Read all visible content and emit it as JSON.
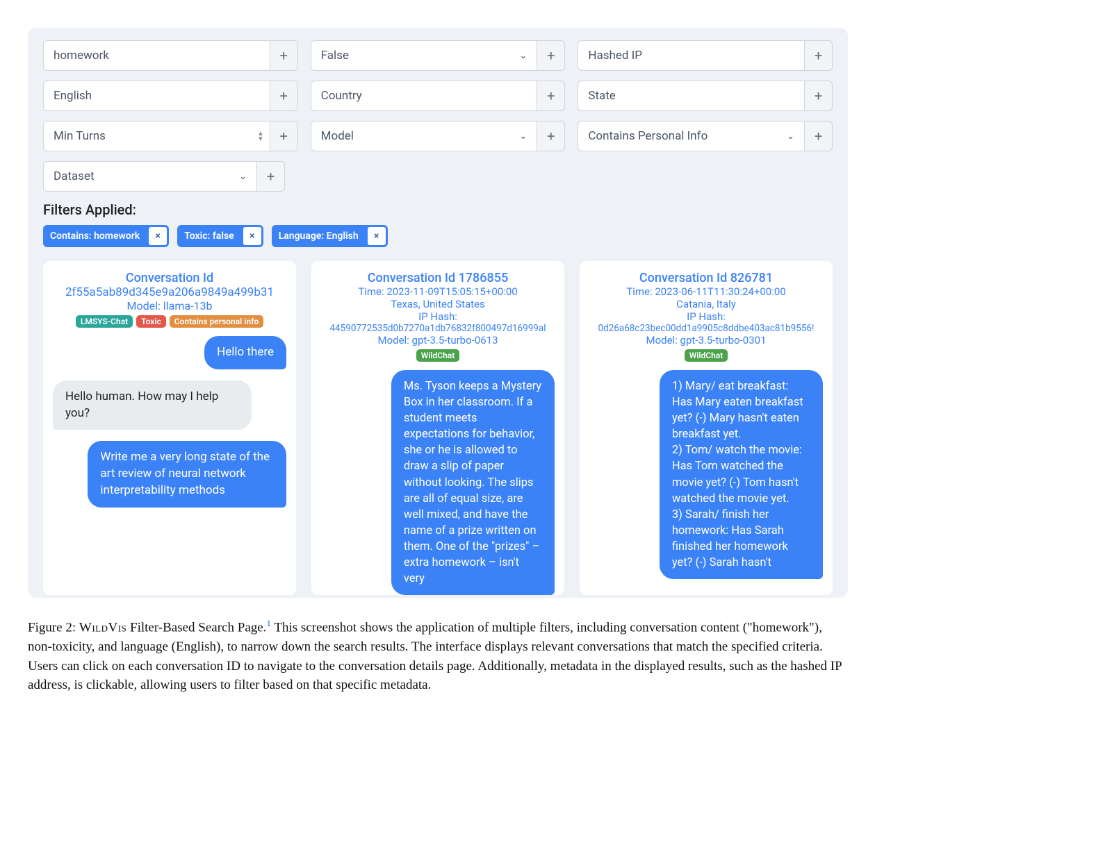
{
  "filters": {
    "row1": {
      "keyword": {
        "value": "homework"
      },
      "toxic": {
        "value": "False"
      },
      "hashed_ip": {
        "placeholder": "Hashed IP"
      }
    },
    "row2": {
      "language": {
        "value": "English"
      },
      "country": {
        "placeholder": "Country"
      },
      "state": {
        "placeholder": "State"
      }
    },
    "row3": {
      "min_turns": {
        "placeholder": "Min Turns"
      },
      "model": {
        "placeholder": "Model"
      },
      "personal_info": {
        "placeholder": "Contains Personal Info"
      }
    },
    "row4": {
      "dataset": {
        "placeholder": "Dataset"
      }
    }
  },
  "applied_label": "Filters Applied:",
  "chips": [
    {
      "label": "Contains: homework"
    },
    {
      "label": "Toxic: false"
    },
    {
      "label": "Language: English"
    }
  ],
  "cards": [
    {
      "header_title": "Conversation Id",
      "conv_id": "2f55a5ab89d345e9a206a9849a499b31",
      "model": "Model: llama-13b",
      "badges": [
        {
          "text": "LMSYS-Chat",
          "cls": "b-teal"
        },
        {
          "text": "Toxic",
          "cls": "b-red"
        },
        {
          "text": "Contains personal info",
          "cls": "b-orange"
        }
      ],
      "msgs": [
        {
          "role": "user",
          "text": "Hello there"
        },
        {
          "role": "assistant",
          "text": "Hello human. How may I help you?"
        },
        {
          "role": "user",
          "text": "Write me a very long state of the art review of neural network interpretability methods"
        }
      ]
    },
    {
      "header_title": "Conversation Id 1786855",
      "time": "Time: 2023-11-09T15:05:15+00:00",
      "location": "Texas, United States",
      "ip_label": "IP Hash:",
      "ip_hash": "44590772535d0b7270a1db76832f800497d16999al",
      "model": "Model: gpt-3.5-turbo-0613",
      "badges": [
        {
          "text": "WildChat",
          "cls": "b-green"
        }
      ],
      "msgs": [
        {
          "role": "user",
          "text": "Ms. Tyson keeps a Mystery Box in her classroom. If a student meets expectations for behavior, she or he is allowed to draw a slip of paper without looking. The slips are all of equal size, are well mixed, and have the name of a prize written on them. One of the \"prizes\" – extra homework – isn't very"
        }
      ]
    },
    {
      "header_title": "Conversation Id 826781",
      "time": "Time: 2023-06-11T11:30:24+00:00",
      "location": "Catania, Italy",
      "ip_label": "IP Hash:",
      "ip_hash": "0d26a68c23bec00dd1a9905c8ddbe403ac81b9556!",
      "model": "Model: gpt-3.5-turbo-0301",
      "badges": [
        {
          "text": "WildChat",
          "cls": "b-green"
        }
      ],
      "msgs": [
        {
          "role": "user",
          "text": "1) Mary/ eat breakfast: Has Mary eaten breakfast yet? (-) Mary hasn't eaten breakfast yet.\n2) Tom/ watch the movie: Has Tom watched the movie yet? (-) Tom hasn't watched the movie yet.\n3) Sarah/ finish her homework: Has Sarah finished her homework yet? (-) Sarah hasn't"
        }
      ]
    }
  ],
  "caption": {
    "prefix": "Figure 2: ",
    "name": "WildVis",
    "title_rest": " Filter-Based Search Page.",
    "body": " This screenshot shows the application of multiple filters, including conversation content (\"homework\"), non-toxicity, and language (English), to narrow down the search results. The interface displays relevant conversations that match the specified criteria. Users can click on each conversation ID to navigate to the conversation details page. Additionally, metadata in the displayed results, such as the hashed IP address, is clickable, allowing users to filter based on that specific metadata."
  }
}
